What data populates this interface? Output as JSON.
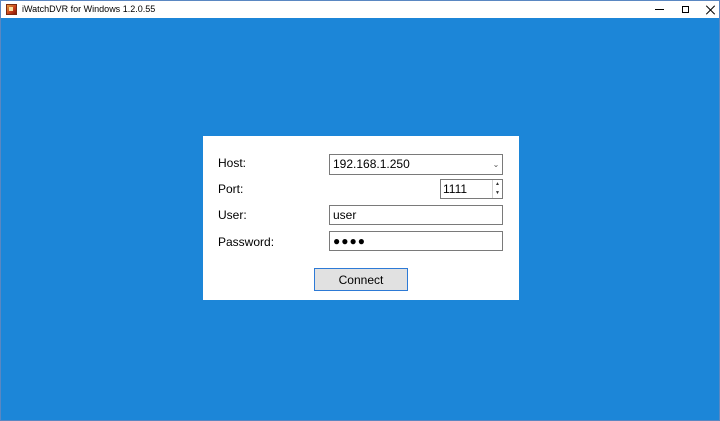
{
  "window": {
    "title": "iWatchDVR for Windows 1.2.0.55",
    "background_color": "#1c86d8",
    "controls": {
      "minimize": "minimize-icon",
      "maximize": "maximize-icon",
      "close": "close-icon"
    }
  },
  "login": {
    "host": {
      "label": "Host:",
      "value": "192.168.1.250"
    },
    "port": {
      "label": "Port:",
      "value": "1111"
    },
    "user": {
      "label": "User:",
      "value": "user"
    },
    "password": {
      "label": "Password:",
      "masked_value": "●●●●"
    },
    "connect_label": "Connect",
    "accent_color": "#2d7ad6"
  }
}
